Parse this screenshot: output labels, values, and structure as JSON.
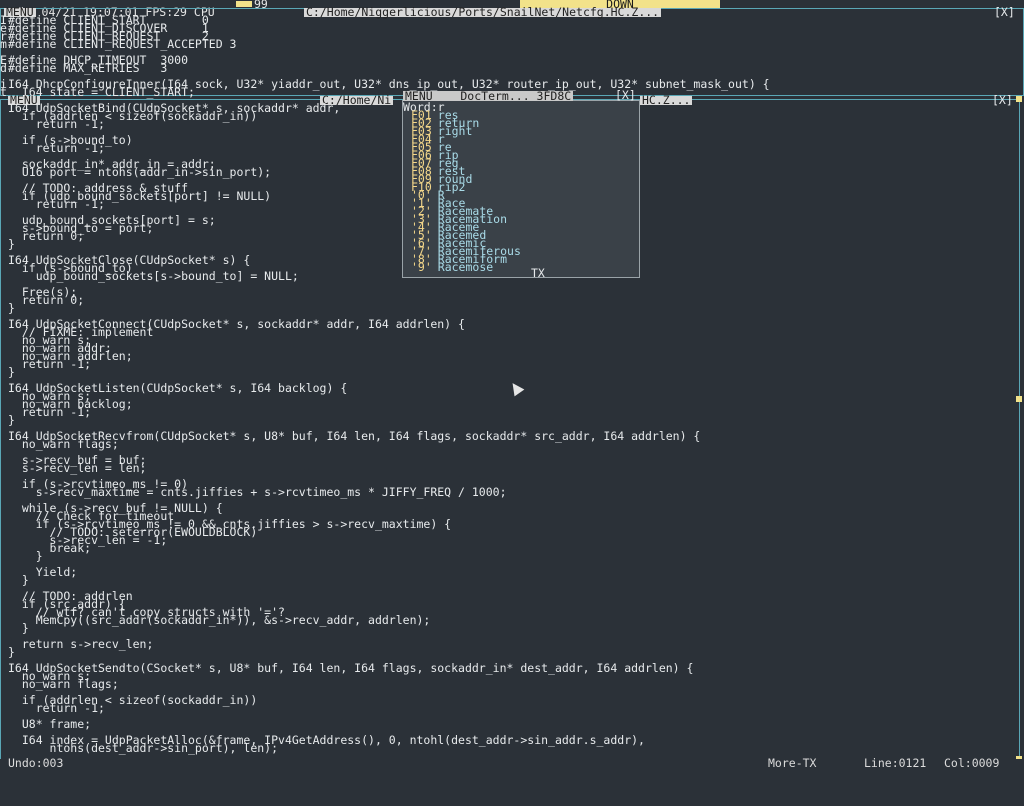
{
  "status": {
    "date_time": "Thu 04/21 19:07:01",
    "fps": "FPS:29",
    "cpu_label": "CPU",
    "cpu_value": "99",
    "down_label": "DOWN"
  },
  "windows": {
    "back": {
      "title": "C:/Home/Niggerlicious/Ports/SnailNet/Netcfg.HC.Z...",
      "close": "[X]",
      "menu": "MENU"
    },
    "front": {
      "title": "C:/Home/Ni",
      "close": "[X]",
      "menu": "MENU",
      "tail": "HC.Z..."
    }
  },
  "back_code": [
    "#define CLIENT_START        0",
    "#define CLIENT_DISCOVER     1",
    "#define CLIENT_REQUEST      2",
    "#define CLIENT_REQUEST_ACCEPTED 3",
    "",
    "#define DHCP_TIMEOUT  3000",
    "#define MAX_RETRIES   3",
    "",
    "I64 DhcpConfigureInner(I64 sock, U32* yiaddr_out, U32* dns_ip_out, U32* router_ip_out, U32* subnet_mask_out) {",
    "  I64 state = CLIENT_START;"
  ],
  "front_code": [
    "I64 UdpSocketBind(CUdpSocket* s, sockaddr* addr, ",
    "  if (addrlen < sizeof(sockaddr_in))",
    "    return -1;",
    "",
    "  if (s->bound_to)",
    "    return -1;",
    "",
    "  sockaddr_in* addr_in = addr;",
    "  U16 port = ntohs(addr_in->sin_port);",
    "",
    "  // TODO: address & stuff",
    "  if (udp_bound_sockets[port] != NULL)",
    "    return -1;",
    "",
    "  udp_bound_sockets[port] = s;",
    "  s->bound_to = port;",
    "  return 0;",
    "}",
    "",
    "I64 UdpSocketClose(CUdpSocket* s) {",
    "  if (s->bound_to)",
    "    udp_bound_sockets[s->bound_to] = NULL;",
    "",
    "  Free(s);",
    "  return 0;",
    "}",
    "",
    "I64 UdpSocketConnect(CUdpSocket* s, sockaddr* addr, I64 addrlen) {",
    "  // FIXME: implement",
    "  no_warn s;",
    "  no_warn addr;",
    "  no_warn addrlen;",
    "  return -1;",
    "}",
    "",
    "I64 UdpSocketListen(CUdpSocket* s, I64 backlog) {",
    "  no_warn s;",
    "  no_warn backlog;",
    "  return -1;",
    "}",
    "",
    "I64 UdpSocketRecvfrom(CUdpSocket* s, U8* buf, I64 len, I64 flags, sockaddr* src_addr, I64 addrlen) {",
    "  no_warn flags;",
    "",
    "  s->recv_buf = buf;",
    "  s->recv_len = len;",
    "",
    "  if (s->rcvtimeo_ms != 0)",
    "    s->recv_maxtime = cnts.jiffies + s->rcvtimeo_ms * JIFFY_FREQ / 1000;",
    "",
    "  while (s->recv_buf != NULL) {",
    "    // Check for timeout",
    "    if (s->rcvtimeo_ms != 0 && cnts.jiffies > s->recv_maxtime) {",
    "      // TODO: seterror(EWOULDBLOCK)",
    "      s->recv_len = -1;",
    "      break;",
    "    }",
    "",
    "    Yield;",
    "  }",
    "",
    "  // TODO: addrlen",
    "  if (src_addr) {",
    "    // wtf? can't copy structs with '='?",
    "    MemCpy((src_addr(sockaddr_in*)), &s->recv_addr, addrlen);",
    "  }",
    "",
    "  return s->recv_len;",
    "}",
    "",
    "I64 UdpSocketSendto(CSocket* s, U8* buf, I64 len, I64 flags, sockaddr_in* dest_addr, I64 addrlen) {",
    "  no_warn s;",
    "  no_warn flags;",
    "",
    "  if (addrlen < sizeof(sockaddr_in))",
    "    return -1;",
    "",
    "  U8* frame;",
    "",
    "  I64 index = UdpPacketAlloc(&frame, IPv4GetAddress(), 0, ntohl(dest_addr->sin_addr.s_addr),",
    "      ntohs(dest_addr->sin_port), len);"
  ],
  "side_letters": [
    "I",
    "e",
    "r",
    "m",
    "",
    "E",
    "d",
    "",
    "i",
    "t"
  ],
  "popup": {
    "title": "MENU    DocTerm... 3FD8C",
    "close": "[X]",
    "word_label": "Word:r",
    "items": [
      {
        "key": "F01",
        "val": "res"
      },
      {
        "key": "F02",
        "val": "return"
      },
      {
        "key": "F03",
        "val": "right"
      },
      {
        "key": "F04",
        "val": "r"
      },
      {
        "key": "F05",
        "val": "re"
      },
      {
        "key": "F06",
        "val": "rip"
      },
      {
        "key": "F07",
        "val": "reg"
      },
      {
        "key": "F08",
        "val": "rest"
      },
      {
        "key": "F09",
        "val": "round"
      },
      {
        "key": "F10",
        "val": "rip2"
      },
      {
        "key": "'0'",
        "val": "R"
      },
      {
        "key": "'1'",
        "val": "Race"
      },
      {
        "key": "'2'",
        "val": "Racemate"
      },
      {
        "key": "'3'",
        "val": "Racemation"
      },
      {
        "key": "'4'",
        "val": "Raceme"
      },
      {
        "key": "'5'",
        "val": "Racemed"
      },
      {
        "key": "'6'",
        "val": "Racemic"
      },
      {
        "key": "'7'",
        "val": "Racemiferous"
      },
      {
        "key": "'8'",
        "val": "Racemiform"
      },
      {
        "key": "'9'",
        "val": "Racemose"
      }
    ],
    "footer": "TX"
  },
  "bottom": {
    "undo": "Undo:003",
    "more": "More-TX",
    "line": "Line:0121",
    "col": "Col:0009"
  }
}
